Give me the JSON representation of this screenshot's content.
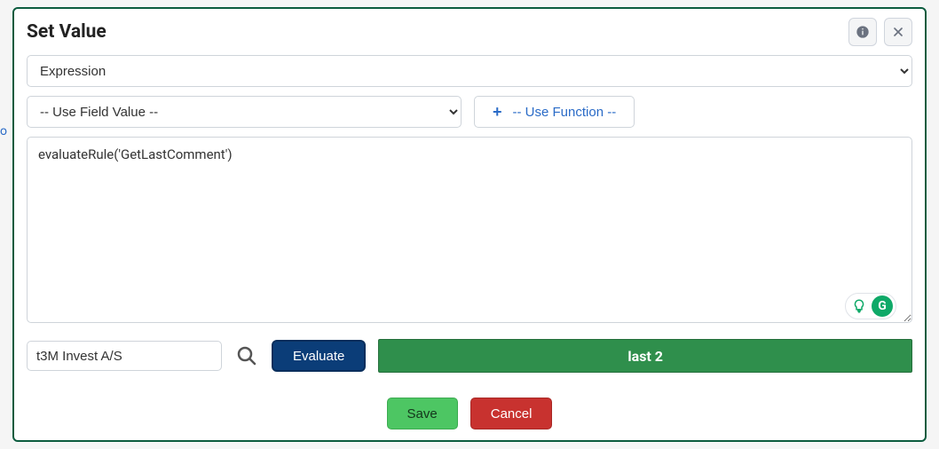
{
  "modal": {
    "title": "Set Value",
    "type_select": "Expression",
    "field_select": "-- Use Field Value --",
    "use_function_label": "-- Use Function --",
    "expression_value": "evaluateRule('GetLastComment')",
    "eval_input_value": "t3M Invest A/S",
    "evaluate_label": "Evaluate",
    "result_text": "last 2",
    "save_label": "Save",
    "cancel_label": "Cancel"
  },
  "background": {
    "left_hint": "o"
  }
}
